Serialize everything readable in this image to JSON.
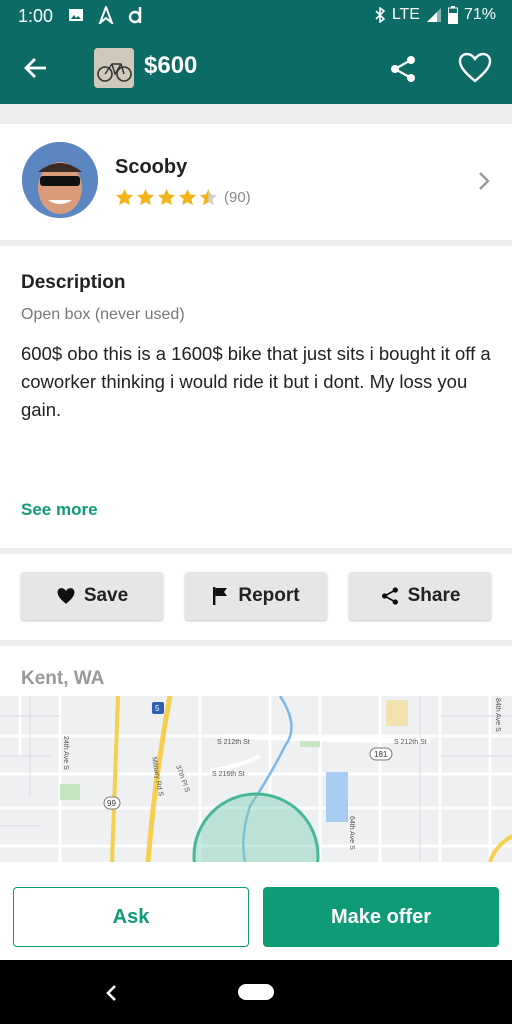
{
  "status": {
    "time": "1:00",
    "network": "LTE",
    "battery": "71%"
  },
  "header": {
    "price": "$600"
  },
  "seller": {
    "name": "Scooby",
    "rating_count": "(90)",
    "rating": 4.5
  },
  "description": {
    "title": "Description",
    "condition": "Open box (never used)",
    "body": "600$ obo this is a 1600$ bike that just sits i bought it off a coworker thinking i would ride it but i dont. My loss you gain.",
    "see_more": "See more"
  },
  "actions": {
    "save": "Save",
    "report": "Report",
    "share": "Share"
  },
  "location": {
    "label": "Kent, WA"
  },
  "map": {
    "labels": [
      "24th Ave S",
      "Military Rd S",
      "37th Pl S",
      "S 212th St",
      "S 212th St",
      "S 216th St",
      "64th Ave S",
      "84th Ave S",
      "181",
      "99",
      "5"
    ]
  },
  "bottom": {
    "ask": "Ask",
    "make_offer": "Make offer"
  },
  "colors": {
    "brand": "#0d6b66",
    "accent": "#0f9b77"
  }
}
